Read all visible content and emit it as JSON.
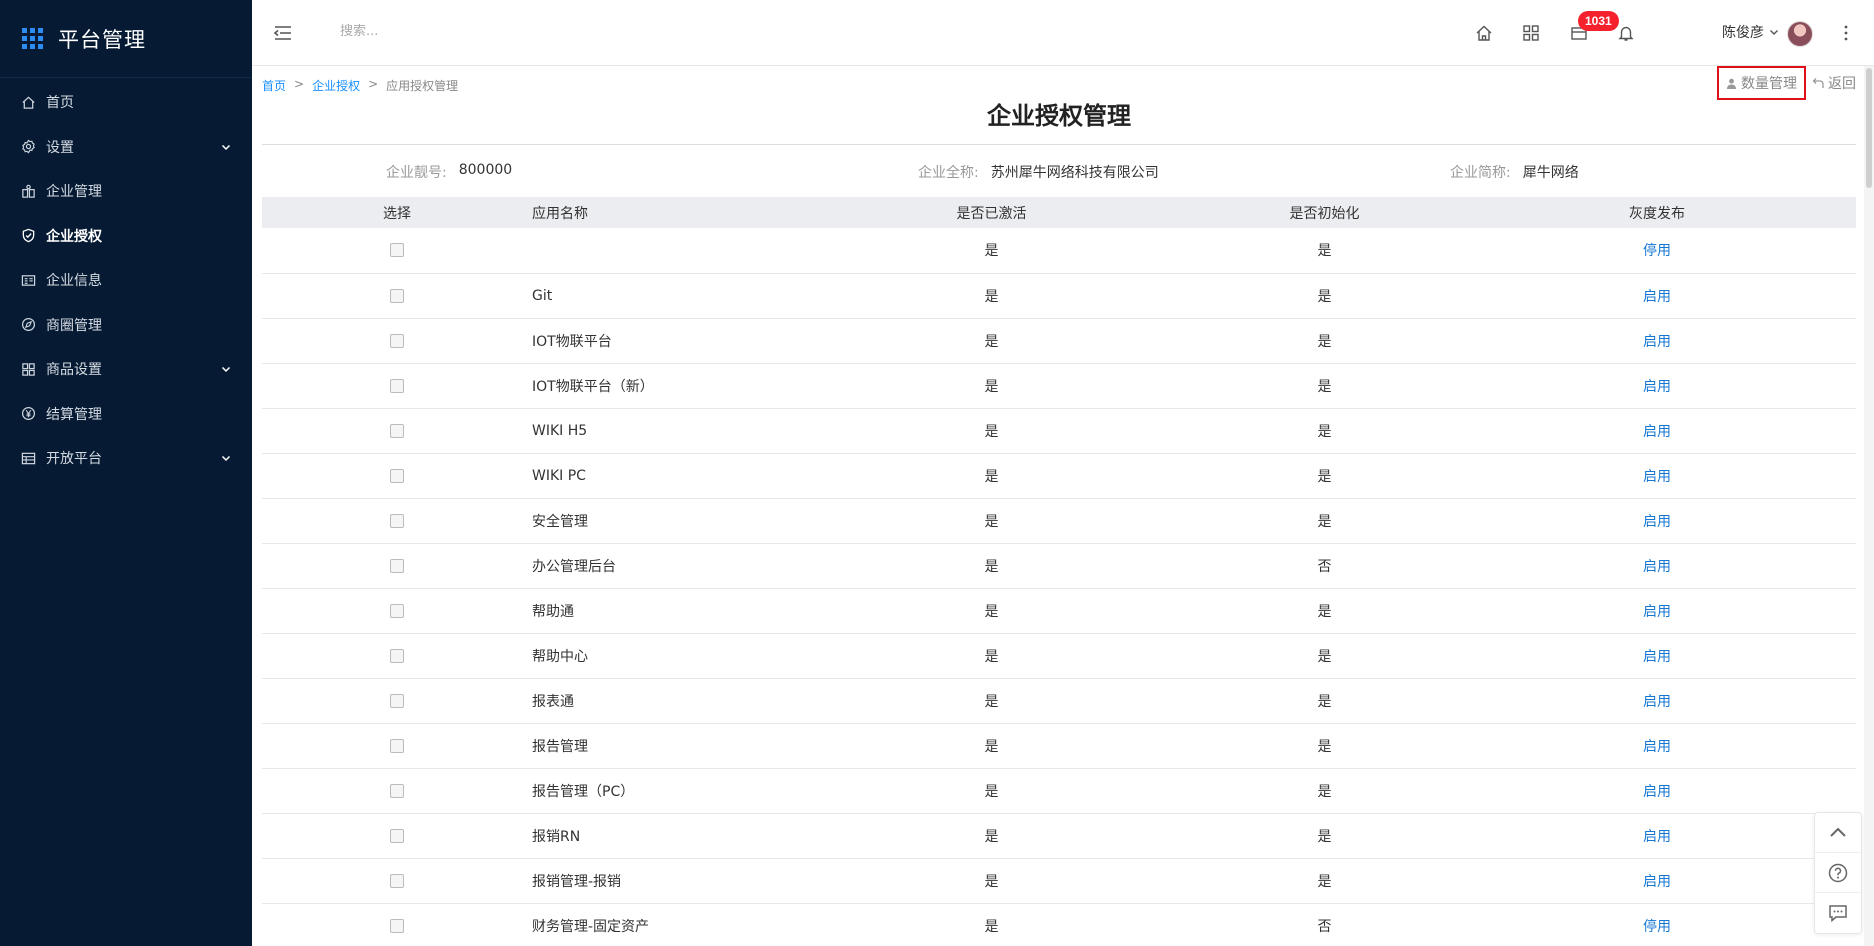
{
  "brand": {
    "title": "平台管理"
  },
  "sidebar": {
    "items": [
      {
        "label": "首页",
        "icon": "home-icon",
        "expandable": false,
        "active": false
      },
      {
        "label": "设置",
        "icon": "settings-icon",
        "expandable": true,
        "active": false
      },
      {
        "label": "企业管理",
        "icon": "building-icon",
        "expandable": false,
        "active": false
      },
      {
        "label": "企业授权",
        "icon": "shield-icon",
        "expandable": false,
        "active": true
      },
      {
        "label": "企业信息",
        "icon": "info-card-icon",
        "expandable": false,
        "active": false
      },
      {
        "label": "商圈管理",
        "icon": "compass-icon",
        "expandable": false,
        "active": false
      },
      {
        "label": "商品设置",
        "icon": "grid-icon",
        "expandable": true,
        "active": false
      },
      {
        "label": "结算管理",
        "icon": "yen-icon",
        "expandable": false,
        "active": false
      },
      {
        "label": "开放平台",
        "icon": "table-icon",
        "expandable": true,
        "active": false
      }
    ]
  },
  "header": {
    "search_placeholder": "搜索...",
    "badge_count": "1031",
    "user_name": "陈俊彦"
  },
  "breadcrumb": {
    "home": "首页",
    "parent": "企业授权",
    "current": "应用授权管理",
    "separator": ">"
  },
  "page": {
    "title": "企业授权管理",
    "qty_button": "数量管理",
    "back_button": "返回"
  },
  "company": {
    "code_label": "企业靓号:",
    "code_value": "800000",
    "fullname_label": "企业全称:",
    "fullname_value": "苏州犀牛网络科技有限公司",
    "shortname_label": "企业简称:",
    "shortname_value": "犀牛网络"
  },
  "table": {
    "headers": {
      "select": "选择",
      "name": "应用名称",
      "activated": "是否已激活",
      "initialized": "是否初始化",
      "gray": "灰度发布"
    },
    "rows": [
      {
        "name": "",
        "activated": "是",
        "initialized": "是",
        "gray": "停用"
      },
      {
        "name": "Git",
        "activated": "是",
        "initialized": "是",
        "gray": "启用"
      },
      {
        "name": "IOT物联平台",
        "activated": "是",
        "initialized": "是",
        "gray": "启用"
      },
      {
        "name": "IOT物联平台（新）",
        "activated": "是",
        "initialized": "是",
        "gray": "启用"
      },
      {
        "name": "WIKI H5",
        "activated": "是",
        "initialized": "是",
        "gray": "启用"
      },
      {
        "name": "WIKI PC",
        "activated": "是",
        "initialized": "是",
        "gray": "启用"
      },
      {
        "name": "安全管理",
        "activated": "是",
        "initialized": "是",
        "gray": "启用"
      },
      {
        "name": "办公管理后台",
        "activated": "是",
        "initialized": "否",
        "gray": "启用"
      },
      {
        "name": "帮助通",
        "activated": "是",
        "initialized": "是",
        "gray": "启用"
      },
      {
        "name": "帮助中心",
        "activated": "是",
        "initialized": "是",
        "gray": "启用"
      },
      {
        "name": "报表通",
        "activated": "是",
        "initialized": "是",
        "gray": "启用"
      },
      {
        "name": "报告管理",
        "activated": "是",
        "initialized": "是",
        "gray": "启用"
      },
      {
        "name": "报告管理（PC）",
        "activated": "是",
        "initialized": "是",
        "gray": "启用"
      },
      {
        "name": "报销RN",
        "activated": "是",
        "initialized": "是",
        "gray": "启用"
      },
      {
        "name": "报销管理-报销",
        "activated": "是",
        "initialized": "是",
        "gray": "启用"
      },
      {
        "name": "财务管理-固定资产",
        "activated": "是",
        "initialized": "否",
        "gray": "停用"
      }
    ]
  },
  "colors": {
    "sidebar_bg": "#061b33",
    "link": "#1677d3",
    "badge": "#f5222d",
    "highlight_border": "#e0101a"
  }
}
